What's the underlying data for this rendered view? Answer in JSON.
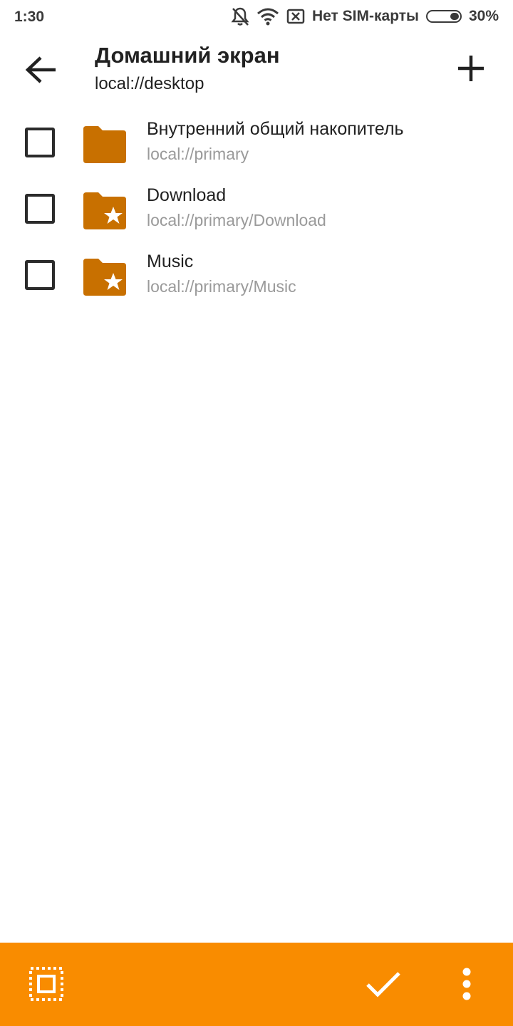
{
  "status_bar": {
    "time": "1:30",
    "carrier": "Нет SIM-карты",
    "battery": "30%",
    "icons": [
      "mute-notifications-icon",
      "wifi-icon",
      "no-sim-icon",
      "battery-icon"
    ]
  },
  "app_bar": {
    "title": "Домашний экран",
    "subtitle": "local://desktop",
    "back_icon": "arrow-back-icon",
    "add_icon": "plus-icon"
  },
  "items": [
    {
      "title": "Внутренний общий накопитель",
      "path": "local://primary",
      "icon": "folder-icon",
      "checked": false
    },
    {
      "title": "Download",
      "path": "local://primary/Download",
      "icon": "folder-star-icon",
      "checked": false
    },
    {
      "title": "Music",
      "path": "local://primary/Music",
      "icon": "folder-star-icon",
      "checked": false
    }
  ],
  "bottom_bar": {
    "icons": [
      "select-all-icon",
      "check-icon",
      "more-vert-icon"
    ]
  },
  "colors": {
    "accent": "#f98c00",
    "folder": "#c87000",
    "text_primary": "#212121",
    "text_secondary": "#9a9a9a"
  }
}
